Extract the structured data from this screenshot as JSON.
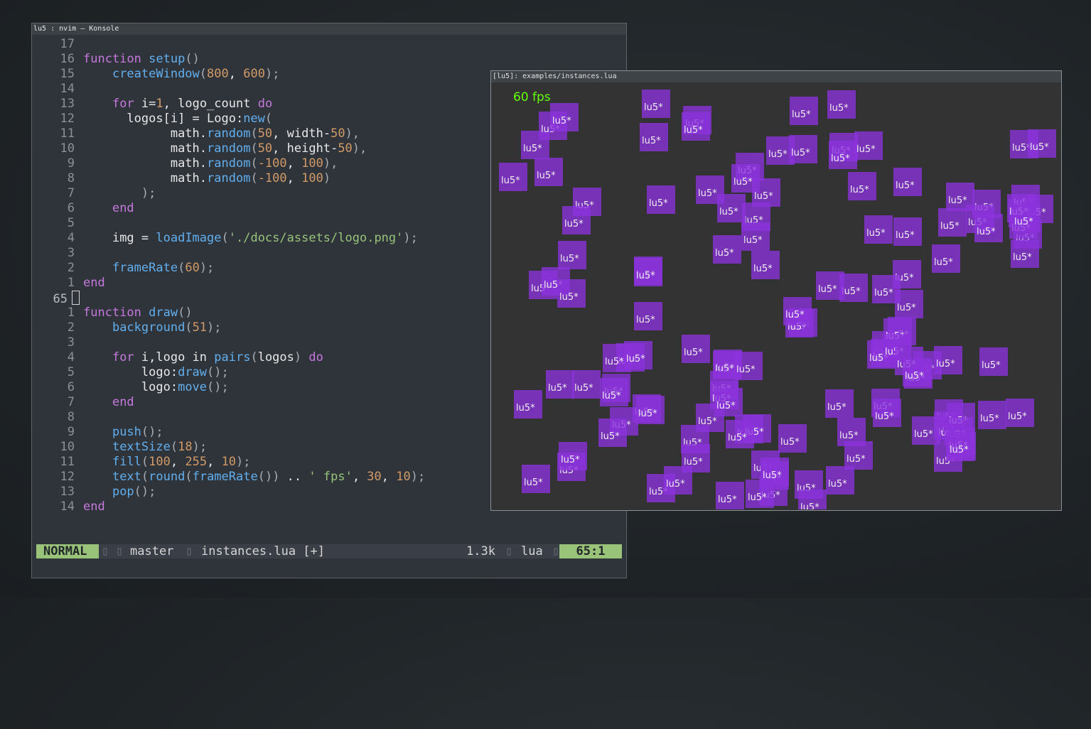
{
  "konsole": {
    "title": "lu5 : nvim — Konsole"
  },
  "editor": {
    "lines": [
      {
        "num": "17"
      },
      {
        "num": "16"
      },
      {
        "num": "15"
      },
      {
        "num": "14"
      },
      {
        "num": "13"
      },
      {
        "num": "12"
      },
      {
        "num": "11"
      },
      {
        "num": "10"
      },
      {
        "num": "9"
      },
      {
        "num": "8"
      },
      {
        "num": "7"
      },
      {
        "num": "6"
      },
      {
        "num": "5"
      },
      {
        "num": "4"
      },
      {
        "num": "3"
      },
      {
        "num": "2"
      },
      {
        "num": "1"
      },
      {
        "num": "65"
      },
      {
        "num": "1"
      },
      {
        "num": "2"
      },
      {
        "num": "3"
      },
      {
        "num": "4"
      },
      {
        "num": "5"
      },
      {
        "num": "6"
      },
      {
        "num": "7"
      },
      {
        "num": "8"
      },
      {
        "num": "9"
      },
      {
        "num": "10"
      },
      {
        "num": "11"
      },
      {
        "num": "12"
      },
      {
        "num": "13"
      },
      {
        "num": "14"
      }
    ],
    "tokens": {
      "function": "function",
      "setup": "setup",
      "paren_pair": "()",
      "createWindow": "createWindow",
      "open": "(",
      "close_semi": ");",
      "n800": "800",
      "comma_sp": ", ",
      "n600": "600",
      "for": "for",
      "i_eq": " i=",
      "n1": "1",
      "logo_count": ", logo_count ",
      "do": "do",
      "logos_i": "logos[i] = Logo:",
      "new": "new",
      "math": "math.",
      "random": "random",
      "n50": "50",
      "width_": "width-",
      "height_": "height-",
      "comma": "),",
      "close": ")",
      "neg100": "-100",
      "n100": "100",
      "close_paren_semi": ");",
      "end": "end",
      "img_eq": "img = ",
      "loadImage": "loadImage",
      "logo_path": "'./docs/assets/logo.png'",
      "frameRate": "frameRate",
      "n60": "60",
      "draw": "draw",
      "background": "background",
      "n51": "51",
      "i_logo_in": " i,logo in ",
      "pairs": "pairs",
      "logos_arg": "logos",
      "logo_colon": "logo:",
      "call_semi": "();",
      "move": "move",
      "push": "push",
      "textSize": "textSize",
      "n18": "18",
      "fill": "fill",
      "n255": "255",
      "n10": "10",
      "text": "text",
      "round": "round",
      "frameRate_call": "())",
      "concat": " .. ",
      "fps_str": "' fps'",
      "n30": "30",
      "pop": "pop"
    }
  },
  "statusline": {
    "mode": "NORMAL",
    "branch": "master",
    "file": "instances.lua [+]",
    "size": "1.3k",
    "filetype": "lua",
    "position": "65:1"
  },
  "lu5": {
    "title": "[lu5]: examples/instances.lua",
    "fps": "60 fps",
    "logo_text": "lu5*",
    "logo_color": "#8c32dc",
    "fps_color": "#64ff0a"
  }
}
